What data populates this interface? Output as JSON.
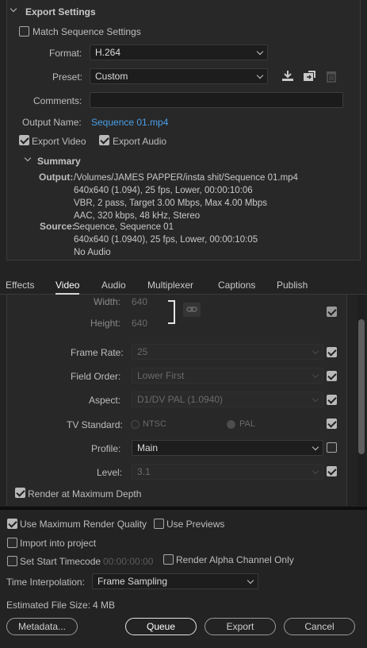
{
  "export_settings": {
    "header": "Export Settings",
    "match_sequence_label": "Match Sequence Settings",
    "match_sequence_checked": false,
    "format_label": "Format:",
    "format_value": "H.264",
    "preset_label": "Preset:",
    "preset_value": "Custom",
    "comments_label": "Comments:",
    "comments_value": "",
    "output_name_label": "Output Name:",
    "output_name_value": "Sequence 01.mp4",
    "export_video_label": "Export Video",
    "export_video_checked": true,
    "export_audio_label": "Export Audio",
    "export_audio_checked": true
  },
  "summary": {
    "header": "Summary",
    "output_label": "Output:",
    "output_lines": [
      "/Volumes/JAMES PAPPER/insta shit/Sequence 01.mp4",
      "640x640 (1.094), 25 fps, Lower, 00:00:10:06",
      "VBR, 2 pass, Target 3.00 Mbps, Max 4.00 Mbps",
      "AAC, 320 kbps, 48 kHz, Stereo"
    ],
    "source_label": "Source:",
    "source_lines": [
      "Sequence, Sequence 01",
      "640x640 (1.0940), 25 fps, Lower, 00:00:10:05",
      "No Audio"
    ]
  },
  "tabs": [
    "Effects",
    "Video",
    "Audio",
    "Multiplexer",
    "Captions",
    "Publish"
  ],
  "active_tab": "Video",
  "video": {
    "width_label": "Width:",
    "width_value": "640",
    "height_label": "Height:",
    "height_value": "640",
    "frame_rate_label": "Frame Rate:",
    "frame_rate_value": "25",
    "field_order_label": "Field Order:",
    "field_order_value": "Lower First",
    "aspect_label": "Aspect:",
    "aspect_value": "D1/DV PAL (1.0940)",
    "tv_standard_label": "TV Standard:",
    "ntsc_label": "NTSC",
    "pal_label": "PAL",
    "profile_label": "Profile:",
    "profile_value": "Main",
    "level_label": "Level:",
    "level_value": "3.1",
    "render_max_depth_label": "Render at Maximum Depth"
  },
  "bottom": {
    "max_render_quality_label": "Use Maximum Render Quality",
    "use_previews_label": "Use Previews",
    "import_project_label": "Import into project",
    "set_start_timecode_label": "Set Start Timecode",
    "timecode_value": "00:00:00:00",
    "render_alpha_label": "Render Alpha Channel Only",
    "time_interpolation_label": "Time Interpolation:",
    "time_interpolation_value": "Frame Sampling",
    "estimated_size_label": "Estimated File Size:",
    "estimated_size_value": "4 MB",
    "metadata_button": "Metadata...",
    "queue_button": "Queue",
    "export_button": "Export",
    "cancel_button": "Cancel"
  },
  "colors": {
    "accent_link": "#4a9fe8",
    "background": "#232323",
    "panel": "#282828"
  }
}
